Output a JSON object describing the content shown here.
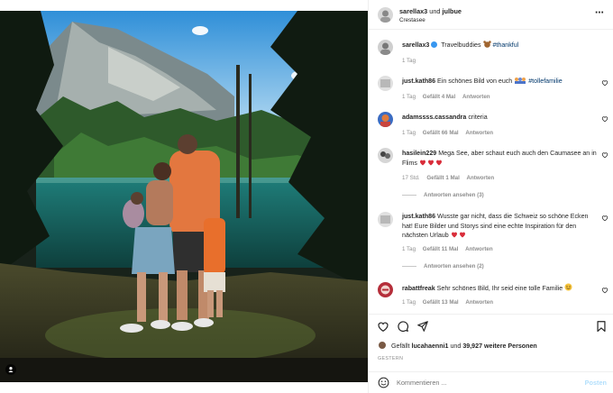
{
  "header": {
    "user1": "sarellax3",
    "and": "und",
    "user2": "julbue",
    "location": "Crestasee",
    "more_icon": "⋯"
  },
  "caption": {
    "user": "sarellax3",
    "text": "Travelbuddies",
    "hashtag": "#thankful",
    "time": "1 Tag"
  },
  "comments": [
    {
      "user": "just.kath86",
      "text": "Ein schönes Bild von euch",
      "hashtag": "#tollefamilie",
      "time": "1 Tag",
      "likes": "Gefällt 4 Mal",
      "reply": "Antworten"
    },
    {
      "user": "adamssss.cassandra",
      "text": "criteria",
      "time": "1 Tag",
      "likes": "Gefällt 66 Mal",
      "reply": "Antworten"
    },
    {
      "user": "hasilein229",
      "text": "Mega See, aber schaut euch auch den Caumasee an in Flims",
      "time": "17 Std.",
      "likes": "Gefällt 1 Mal",
      "reply": "Antworten",
      "view_replies": "Antworten ansehen (3)"
    },
    {
      "user": "just.kath86",
      "text": "Wusste gar nicht, dass die Schweiz so schöne Ecken hat! Eure Bilder und Storys sind eine echte Inspiration für den nächsten Urlaub",
      "time": "1 Tag",
      "likes": "Gefällt 11 Mal",
      "reply": "Antworten",
      "view_replies": "Antworten ansehen (2)"
    },
    {
      "user": "rabattfreak",
      "text": "Sehr schönes Bild, Ihr seid eine tolle Familie",
      "time": "1 Tag",
      "likes": "Gefällt 13 Mal",
      "reply": "Antworten"
    }
  ],
  "likes": {
    "prefix": "Gefällt",
    "user": "lucahaenni1",
    "mid": "und",
    "count": "39,927 weitere Personen"
  },
  "date": "GESTERN",
  "add_comment": {
    "placeholder": "Kommentieren ...",
    "post": "Posten"
  },
  "colors": {
    "heart": "#d92d3a",
    "link": "#00376b",
    "verified": "#3897f0",
    "post_disabled": "#b2dffc"
  },
  "icons": [
    "more-icon",
    "heart-icon",
    "comment-icon",
    "share-icon",
    "bookmark-icon",
    "smile-icon",
    "tag-user-icon",
    "verified-icon"
  ]
}
